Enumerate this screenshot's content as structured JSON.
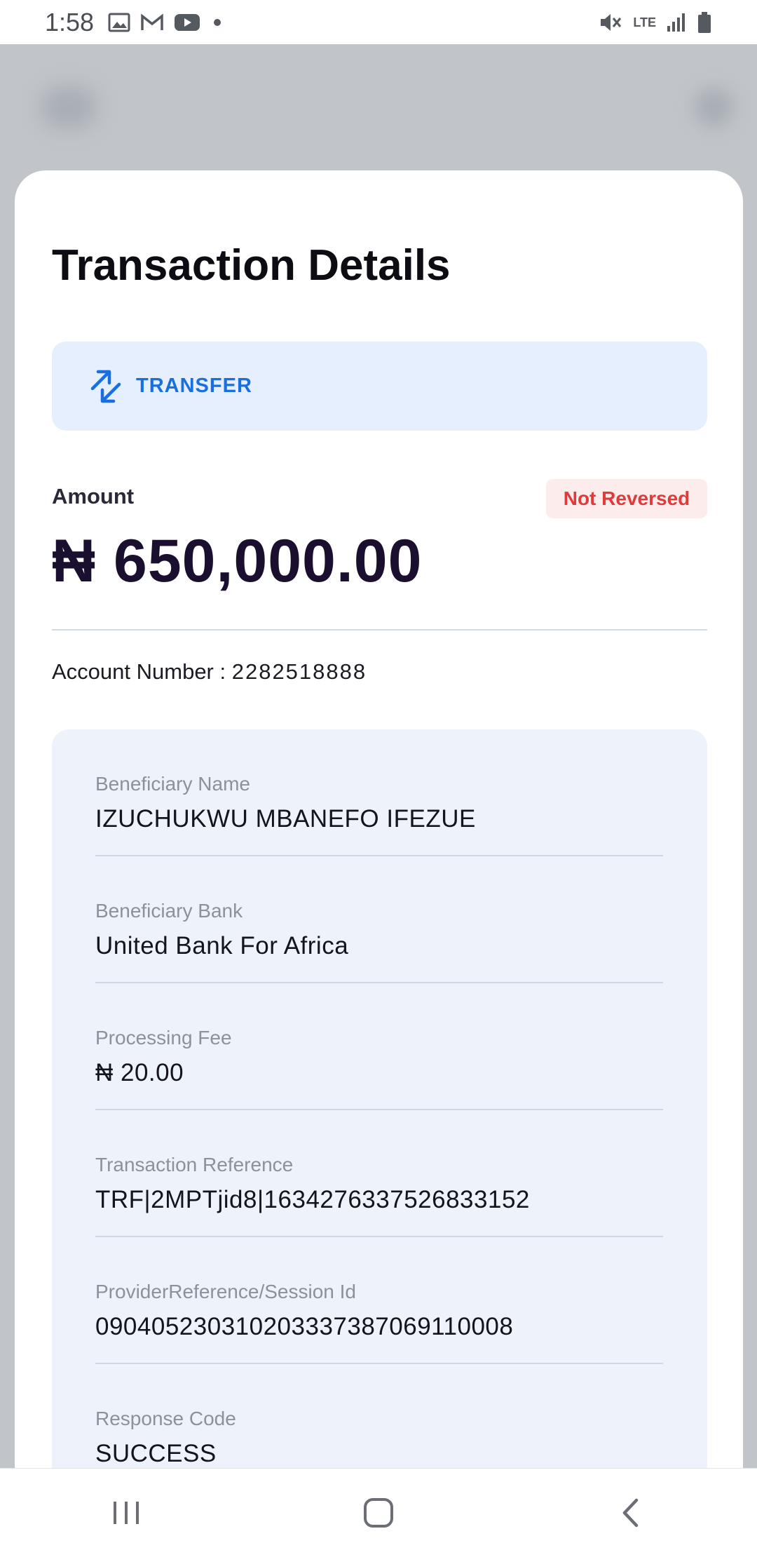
{
  "status_bar": {
    "time": "1:58",
    "left_icons": [
      "image-icon",
      "gmail-icon",
      "youtube-icon",
      "dot-icon"
    ],
    "right_icons": [
      "mute-icon",
      "lte-icon",
      "signal-icon",
      "battery-icon"
    ],
    "lte_label": "LTE"
  },
  "sheet": {
    "title": "Transaction Details",
    "type_banner": {
      "icon": "transfer-arrows-icon",
      "label": "TRANSFER"
    },
    "amount_label": "Amount",
    "reversal_status": "Not Reversed",
    "amount": "₦ 650,000.00",
    "account_label": "Account Number : ",
    "account_number": "2282518888"
  },
  "details": [
    {
      "label": "Beneficiary Name",
      "value": "IZUCHUKWU MBANEFO IFEZUE"
    },
    {
      "label": "Beneficiary Bank",
      "value": "United Bank For Africa"
    },
    {
      "label": "Processing Fee",
      "value": "₦ 20.00"
    },
    {
      "label": "Transaction Reference",
      "value": "TRF|2MPTjid8|1634276337526833152"
    },
    {
      "label": "ProviderReference/Session Id",
      "value": "090405230310203337387069110008"
    },
    {
      "label": "Response Code",
      "value": "SUCCESS"
    }
  ],
  "nav_bar": {
    "buttons": [
      "recents-icon",
      "home-icon",
      "back-icon"
    ]
  },
  "colors": {
    "accent_blue": "#1a6fe0",
    "status_red": "#e03a3a",
    "amount_text": "#1a0f2e",
    "card_bg": "#eef3fb"
  }
}
